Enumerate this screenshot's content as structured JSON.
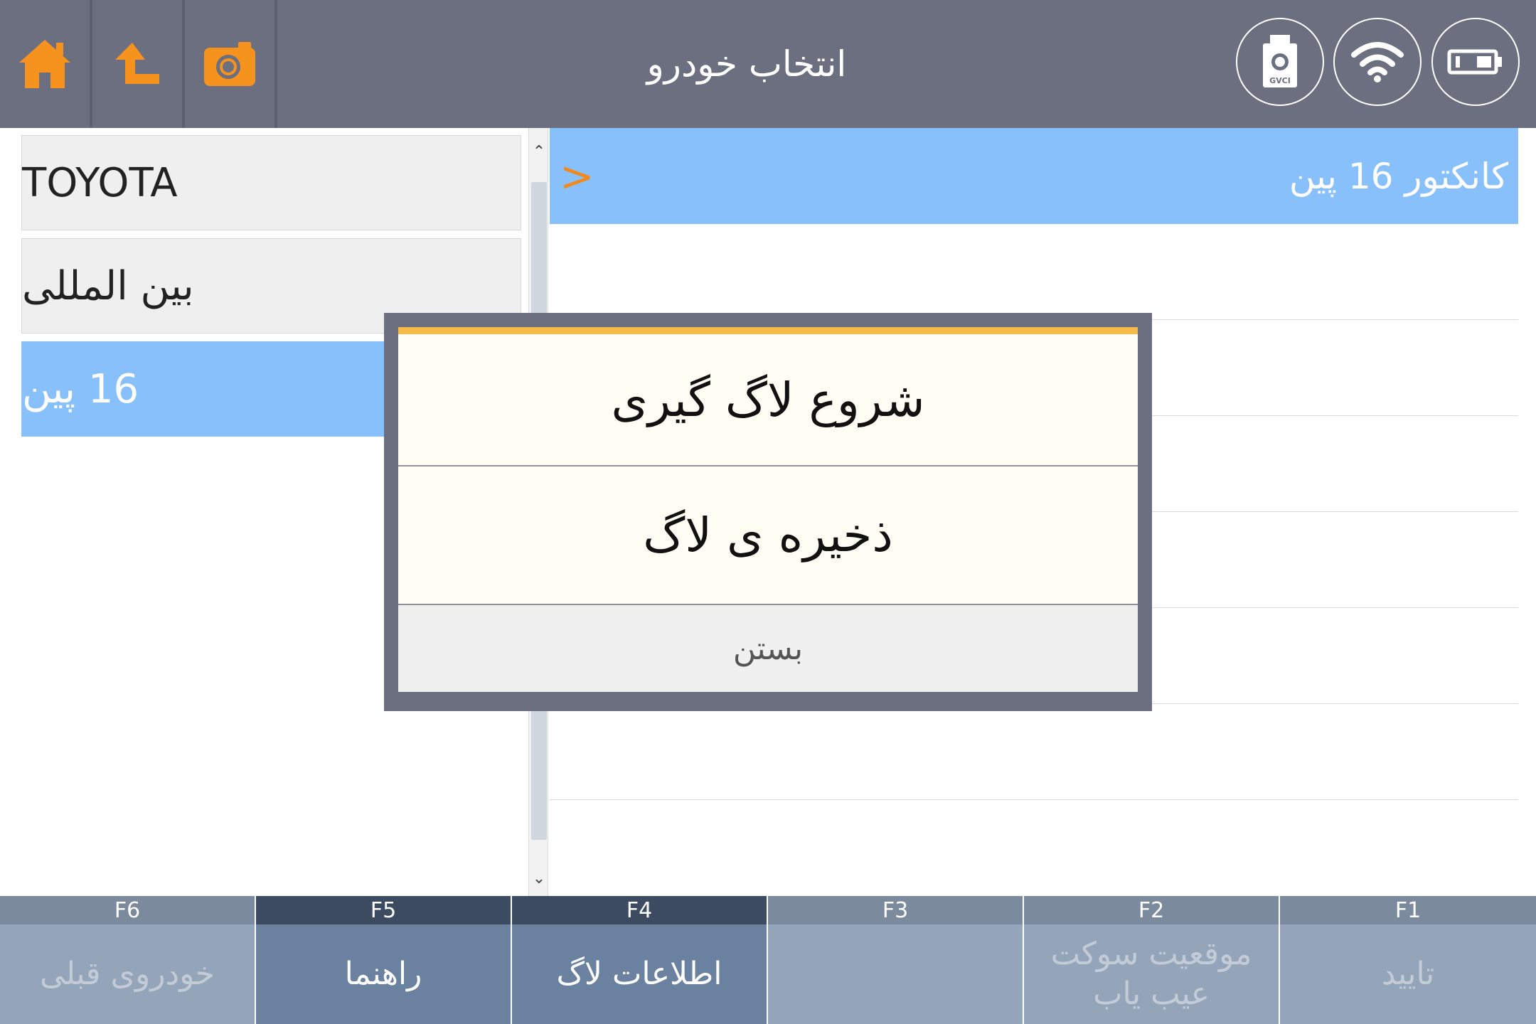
{
  "header": {
    "title": "انتخاب خودرو",
    "left_icons": [
      "home-icon",
      "up-arrow-icon",
      "camera-icon"
    ],
    "right_icons": [
      "gvci-device-icon",
      "wifi-icon",
      "battery-icon"
    ],
    "gvci_label": "GVCI",
    "accent": "#f5931e"
  },
  "left_list": {
    "items": [
      {
        "label": "TOYOTA"
      },
      {
        "label": "بین المللی"
      },
      {
        "label": "16 پین",
        "selected": true
      }
    ]
  },
  "right_list": {
    "selected_label": "کانکتور 16 پین",
    "chevron": ">"
  },
  "modal": {
    "options": [
      "شروع لاگ گیری",
      "ذخیره ی لاگ"
    ],
    "close_label": "بستن"
  },
  "function_bar": [
    {
      "key": "F6",
      "label": "خودروی قبلی",
      "enabled": false
    },
    {
      "key": "F5",
      "label": "راهنما",
      "enabled": true
    },
    {
      "key": "F4",
      "label": "اطلاعات لاگ",
      "enabled": true
    },
    {
      "key": "F3",
      "label": "",
      "enabled": false
    },
    {
      "key": "F2",
      "label": "موقعیت سوکت عیب یاب",
      "enabled": false
    },
    {
      "key": "F1",
      "label": "تایید",
      "enabled": false
    }
  ],
  "colors": {
    "header_bg": "#6b6f80",
    "selection_blue": "#88c0fb",
    "modal_accent": "#f7bb4c"
  }
}
